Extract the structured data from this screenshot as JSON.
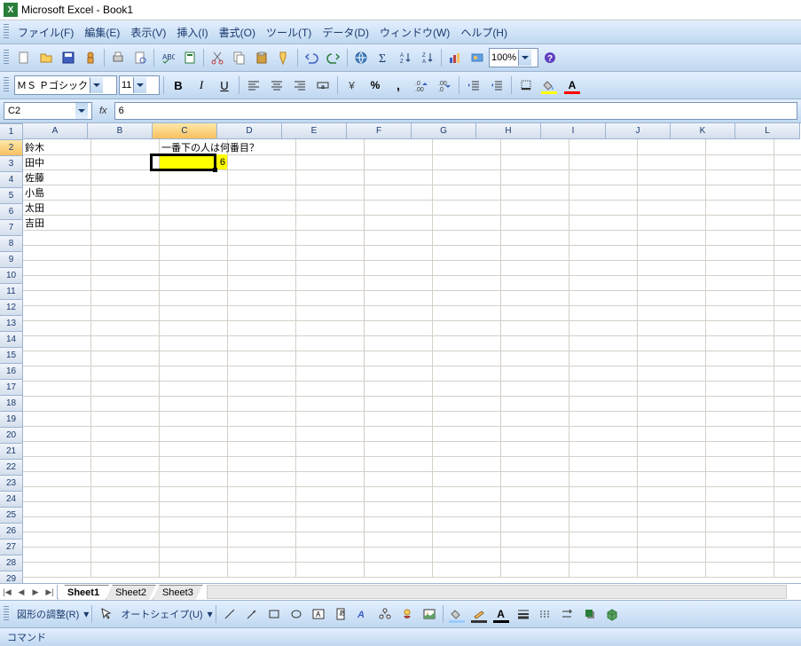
{
  "title": "Microsoft Excel - Book1",
  "menu": {
    "file": "ファイル(F)",
    "edit": "編集(E)",
    "view": "表示(V)",
    "insert": "挿入(I)",
    "format": "書式(O)",
    "tools": "ツール(T)",
    "data": "データ(D)",
    "window": "ウィンドウ(W)",
    "help": "ヘルプ(H)"
  },
  "format_toolbar": {
    "font": "ＭＳ Ｐゴシック",
    "size": "11",
    "zoom": "100%"
  },
  "namebox": "C2",
  "formula": "6",
  "columns": [
    "A",
    "B",
    "C",
    "D",
    "E",
    "F",
    "G",
    "H",
    "I",
    "J",
    "K",
    "L"
  ],
  "rows": [
    "1",
    "2",
    "3",
    "4",
    "5",
    "6",
    "7",
    "8",
    "9",
    "10",
    "11",
    "12",
    "13",
    "14",
    "15",
    "16",
    "17",
    "18",
    "19",
    "20",
    "21",
    "22",
    "23",
    "24",
    "25",
    "26",
    "27",
    "28",
    "29"
  ],
  "cells": {
    "A1": "鈴木",
    "A2": "田中",
    "A3": "佐藤",
    "A4": "小島",
    "A5": "太田",
    "A6": "吉田",
    "C1": "一番下の人は何番目？",
    "C2": "6"
  },
  "selected": {
    "col": "C",
    "row": "2"
  },
  "sheets": [
    "Sheet1",
    "Sheet2",
    "Sheet3"
  ],
  "active_sheet": 0,
  "draw": {
    "adjust": "図形の調整(R)",
    "autoshape": "オートシェイプ(U)"
  },
  "status": "コマンド"
}
